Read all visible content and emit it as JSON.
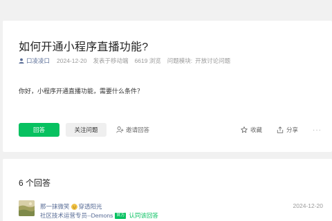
{
  "question": {
    "title": "如何开通小程序直播功能?",
    "author": "口凌凌口",
    "date": "2024-12-20",
    "posted_from": "发表于移动端",
    "views": "6619 浏览",
    "module_label": "问题模块:",
    "module_value": "开放讨论问题",
    "body": "你好，小程序开通直播功能，需要什么条件？"
  },
  "buttons": {
    "answer": "回答",
    "follow": "关注问题",
    "invite": "邀请回答"
  },
  "actions": {
    "favorite": "收藏",
    "share": "分享",
    "more": "···"
  },
  "answers": {
    "count_label": "6 个回答",
    "items": [
      {
        "name_prefix": "那一抹微笑",
        "name_suffix": "穿透阳光",
        "role": "社区技术运营专员--Demons",
        "badge": "官方",
        "endorse": "认同该回答",
        "date": "2024-12-20"
      }
    ]
  },
  "colors": {
    "brand_green": "#07c160",
    "link_blue": "#576b95",
    "muted": "#9a9a9a"
  },
  "icons": [
    "user-icon",
    "invite-icon",
    "star-icon",
    "share-icon",
    "more-icon",
    "smile-emoji-icon"
  ]
}
